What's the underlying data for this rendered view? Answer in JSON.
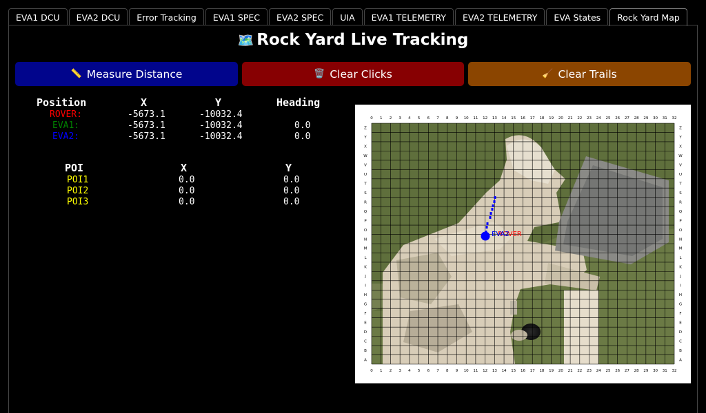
{
  "tabs": [
    {
      "label": "EVA1 DCU"
    },
    {
      "label": "EVA2 DCU"
    },
    {
      "label": "Error Tracking"
    },
    {
      "label": "EVA1 SPEC"
    },
    {
      "label": "EVA2 SPEC"
    },
    {
      "label": "UIA"
    },
    {
      "label": "EVA1 TELEMETRY"
    },
    {
      "label": "EVA2 TELEMETRY"
    },
    {
      "label": "EVA States"
    },
    {
      "label": "Rock Yard Map"
    }
  ],
  "active_tab": "Rock Yard Map",
  "page": {
    "title": "Rock Yard Live Tracking",
    "title_icon": "map-icon"
  },
  "buttons": {
    "measure": {
      "label": "Measure Distance",
      "icon": "ruler-icon",
      "color": "#01058c"
    },
    "clear_clicks": {
      "label": "Clear Clicks",
      "icon": "trash-icon",
      "color": "#870002"
    },
    "clear_trails": {
      "label": "Clear Trails",
      "icon": "broom-icon",
      "color": "#8b4500"
    }
  },
  "position_table": {
    "headers": {
      "name": "Position",
      "x": "X",
      "y": "Y",
      "heading": "Heading"
    },
    "rows": [
      {
        "name": "ROVER:",
        "x": "-5673.1",
        "y": "-10032.4",
        "heading": "",
        "color": "#ff0000"
      },
      {
        "name": "EVA1:",
        "x": "-5673.1",
        "y": "-10032.4",
        "heading": "0.0",
        "color": "#008000"
      },
      {
        "name": "EVA2:",
        "x": "-5673.1",
        "y": "-10032.4",
        "heading": "0.0",
        "color": "#0000ff"
      }
    ]
  },
  "poi_table": {
    "headers": {
      "name": "POI",
      "x": "X",
      "y": "Y"
    },
    "rows": [
      {
        "name": "POI1",
        "x": "0.0",
        "y": "0.0"
      },
      {
        "name": "POI2",
        "x": "0.0",
        "y": "0.0"
      },
      {
        "name": "POI3",
        "x": "0.0",
        "y": "0.0"
      }
    ],
    "color": "#ffff00"
  },
  "map": {
    "grid_columns": [
      "0",
      "1",
      "2",
      "3",
      "4",
      "5",
      "6",
      "7",
      "8",
      "9",
      "10",
      "11",
      "12",
      "13",
      "14",
      "15",
      "16",
      "17",
      "18",
      "19",
      "20",
      "21",
      "22",
      "23",
      "24",
      "25",
      "26",
      "27",
      "28",
      "29",
      "30",
      "31",
      "32"
    ],
    "grid_rows": [
      "Z",
      "Y",
      "X",
      "W",
      "V",
      "U",
      "T",
      "S",
      "R",
      "Q",
      "P",
      "O",
      "N",
      "M",
      "L",
      "K",
      "J",
      "I",
      "H",
      "G",
      "F",
      "E",
      "D",
      "C",
      "B",
      "A"
    ],
    "markers": [
      {
        "label": "ROVER",
        "color": "#ff0000"
      },
      {
        "label": "EVA1",
        "color": "#008000"
      },
      {
        "label": "EVA2",
        "color": "#0000ff"
      }
    ]
  }
}
